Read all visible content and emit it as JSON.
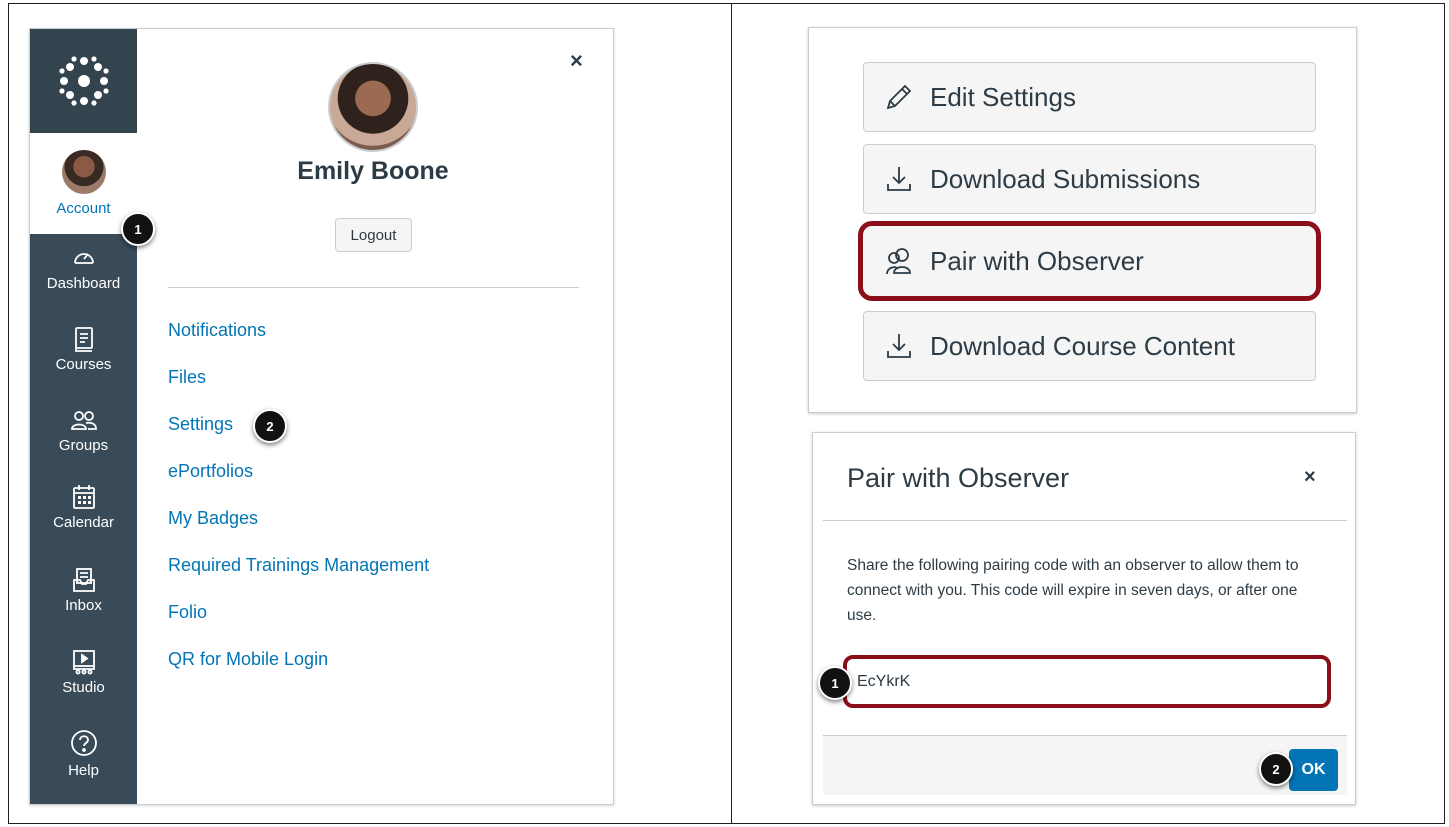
{
  "account_tray": {
    "user_name": "Emily Boone",
    "logout_label": "Logout",
    "close_glyph": "×",
    "links": [
      "Notifications",
      "Files",
      "Settings",
      "ePortfolios",
      "My Badges",
      "Required Trainings Management",
      "Folio",
      "QR for Mobile Login"
    ]
  },
  "global_nav": {
    "account_label": "Account",
    "items": [
      {
        "label": "Dashboard",
        "icon": "dashboard-icon"
      },
      {
        "label": "Courses",
        "icon": "courses-icon"
      },
      {
        "label": "Groups",
        "icon": "groups-icon"
      },
      {
        "label": "Calendar",
        "icon": "calendar-icon"
      },
      {
        "label": "Inbox",
        "icon": "inbox-icon"
      },
      {
        "label": "Studio",
        "icon": "studio-icon"
      },
      {
        "label": "Help",
        "icon": "help-icon"
      }
    ]
  },
  "sidebar_buttons": [
    {
      "label": "Edit Settings",
      "icon": "pencil-icon"
    },
    {
      "label": "Download Submissions",
      "icon": "download-icon"
    },
    {
      "label": "Pair with Observer",
      "icon": "users-icon",
      "highlighted": true
    },
    {
      "label": "Download Course Content",
      "icon": "download-icon"
    }
  ],
  "modal": {
    "title": "Pair with Observer",
    "close_glyph": "×",
    "body": "Share the following pairing code with an observer to allow them to connect with you. This code will expire in seven days, or after one use.",
    "code": "EcYkrK",
    "ok_label": "OK"
  },
  "badges": {
    "left_1": "1",
    "left_2": "2",
    "right_1": "1",
    "right_2": "2"
  },
  "colors": {
    "nav_bg": "#394b58",
    "link": "#0374b5",
    "highlight": "#8b0f1a",
    "ok_button": "#0374b5"
  }
}
